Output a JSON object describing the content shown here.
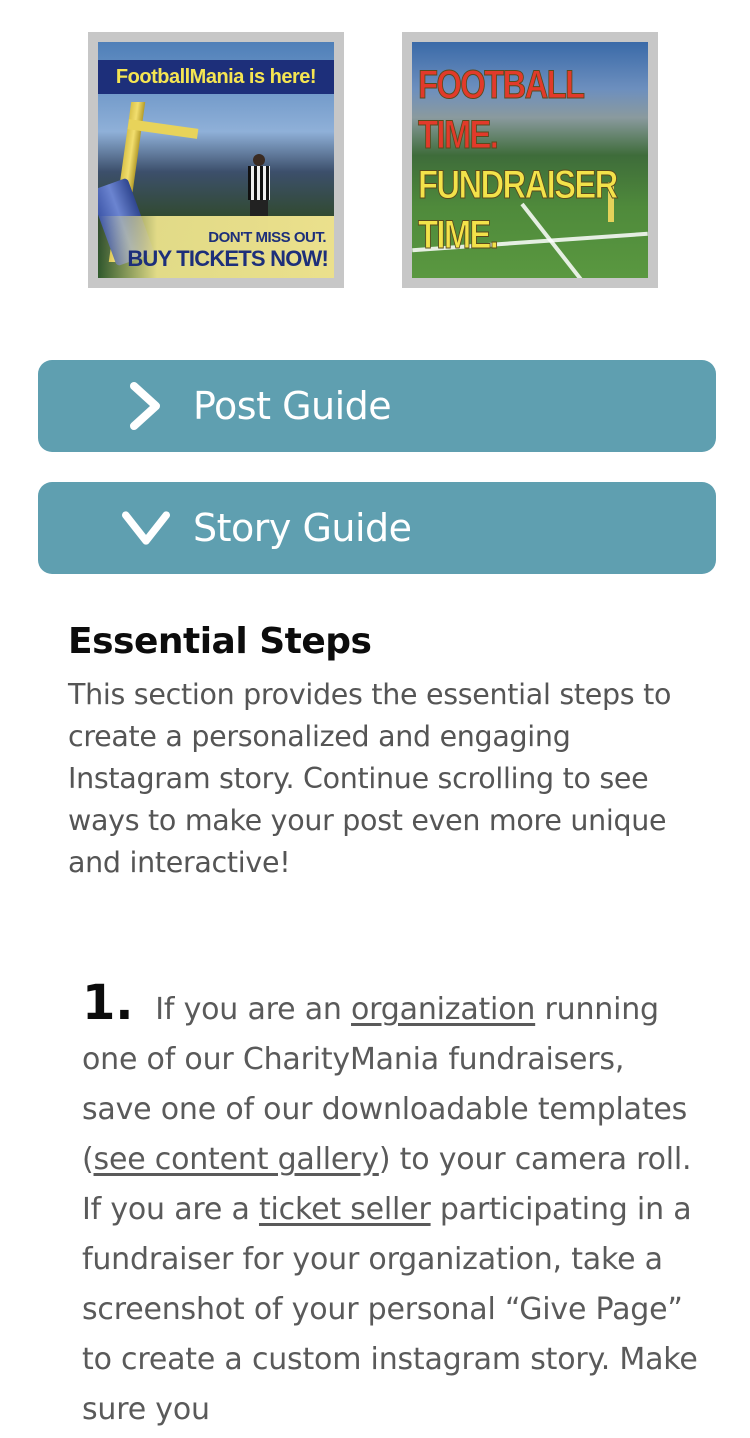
{
  "thumbnails": [
    {
      "banner": "FootballMania is here!",
      "cta_small": "DON'T MISS OUT.",
      "cta_big": "BUY TICKETS NOW!"
    },
    {
      "lines": [
        "FOOTBALL",
        "TIME.",
        "FUNDRAISER",
        "TIME."
      ]
    }
  ],
  "accordions": {
    "post": {
      "label": "Post Guide",
      "icon": "chevron-right-icon",
      "state": "collapsed"
    },
    "story": {
      "label": "Story Guide",
      "icon": "chevron-down-icon",
      "state": "expanded"
    }
  },
  "colors": {
    "accordion_bg": "#5f9fb0",
    "panel_bg": "#f1f2f6",
    "text": "#555555"
  },
  "essential": {
    "title": "Essential Steps",
    "body": "This section provides the essential steps to create a personalized and engaging Instagram story. Continue scrolling to see ways to make your post even more unique and interactive!"
  },
  "step1": {
    "number": "1.",
    "t1": "If you are an ",
    "link_org": "organization",
    "t2": " running one of our CharityMania fundraisers, save one of our downloadable templates (",
    "link_gallery": "see content gallery",
    "t3": ") to your camera roll. If you are a ",
    "link_seller": "ticket seller",
    "t4": " participating in a fundraiser for your organization, take a screenshot of your personal “Give Page” to create a custom instagram story. Make sure you"
  }
}
